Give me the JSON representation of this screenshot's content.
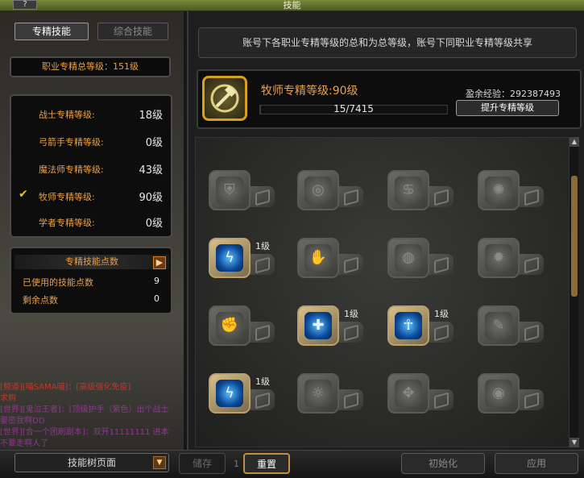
{
  "window": {
    "title": "技能",
    "help": "?"
  },
  "tabs": [
    {
      "label": "专精技能"
    },
    {
      "label": "综合技能"
    }
  ],
  "total_level": "职业专精总等级：151级",
  "jobs": [
    {
      "name": "战士专精等级:",
      "level": "18级",
      "selected": false
    },
    {
      "name": "弓箭手专精等级:",
      "level": "0级",
      "selected": false
    },
    {
      "name": "魔法师专精等级:",
      "level": "43级",
      "selected": false
    },
    {
      "name": "牧师专精等级:",
      "level": "90级",
      "selected": true
    },
    {
      "name": "学者专精等级:",
      "level": "0级",
      "selected": false
    }
  ],
  "points": {
    "header": "专精技能点数",
    "used_label": "已使用的技能点数",
    "used_value": "9",
    "remaining_label": "剩余点数",
    "remaining_value": "0"
  },
  "chat": [
    "[频道][喵SAMA喵]：[高级强化免疫]",
    "求购",
    "[世界][鬼泣王者]：[顶级护手（紫色）出个战士",
    "要密我啊DD",
    "[世界][合一个团刷副本]：双开11111111 进本",
    "不要走啊人了"
  ],
  "notice": "账号下各职业专精等级的总和为总等级，账号下同职业专精等级共享",
  "current_job": {
    "title": "牧师专精等级:90级",
    "exp_text": "15/7415",
    "exp_fraction": 0.002,
    "surplus": "盈余经验：292387493",
    "upgrade_label": "提升专精等级"
  },
  "skills": [
    {
      "icon": "shield-icon",
      "active": false,
      "level": ""
    },
    {
      "icon": "swirl-icon",
      "active": false,
      "level": ""
    },
    {
      "icon": "spiral-icon",
      "active": false,
      "level": ""
    },
    {
      "icon": "burst-icon",
      "active": false,
      "level": ""
    },
    {
      "icon": "lightning-icon",
      "active": true,
      "level": "1级"
    },
    {
      "icon": "claw-icon",
      "active": false,
      "level": ""
    },
    {
      "icon": "orb-icon",
      "active": false,
      "level": ""
    },
    {
      "icon": "flame-icon",
      "active": false,
      "level": ""
    },
    {
      "icon": "fist-icon",
      "active": false,
      "level": ""
    },
    {
      "icon": "target-icon",
      "active": true,
      "level": "1级"
    },
    {
      "icon": "ankh-icon",
      "active": true,
      "level": "1级"
    },
    {
      "icon": "feather-icon",
      "active": false,
      "level": ""
    },
    {
      "icon": "hand-icon",
      "active": true,
      "level": "1级"
    },
    {
      "icon": "sun-icon",
      "active": false,
      "level": ""
    },
    {
      "icon": "beast-icon",
      "active": false,
      "level": ""
    },
    {
      "icon": "ring-icon",
      "active": false,
      "level": ""
    }
  ],
  "bottom": {
    "tree_page": "技能树页面",
    "save": "储存",
    "sep": "1",
    "reset": "重置",
    "init": "初始化",
    "apply": "应用"
  }
}
